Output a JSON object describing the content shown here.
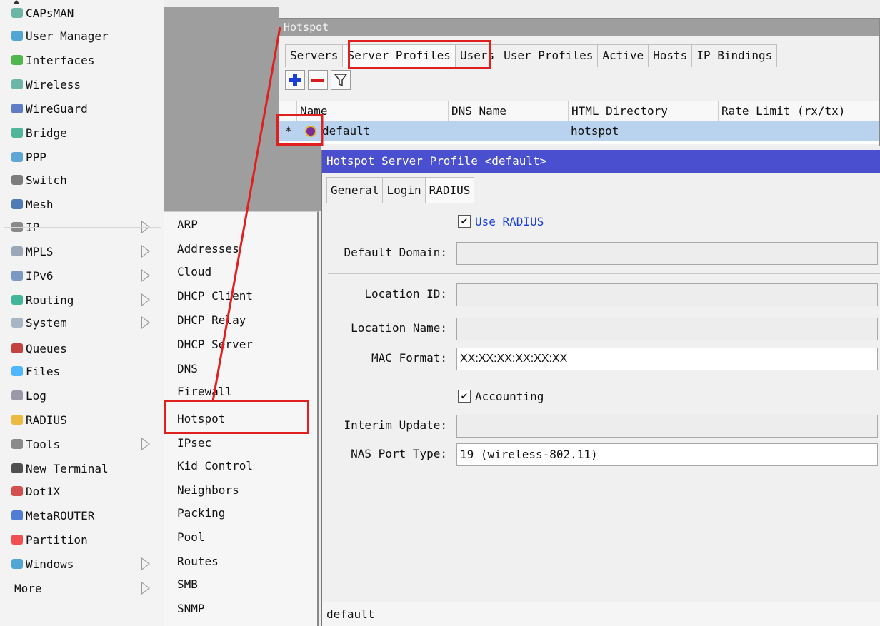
{
  "sidebar": {
    "items": [
      {
        "label": "CAPsMAN",
        "icon": "capsman-icon",
        "submenu": false
      },
      {
        "label": "User Manager",
        "icon": "users-icon",
        "submenu": false
      },
      {
        "label": "Interfaces",
        "icon": "interfaces-icon",
        "submenu": false
      },
      {
        "label": "Wireless",
        "icon": "wireless-icon",
        "submenu": false
      },
      {
        "label": "WireGuard",
        "icon": "wireguard-icon",
        "submenu": false
      },
      {
        "label": "Bridge",
        "icon": "bridge-icon",
        "submenu": false
      },
      {
        "label": "PPP",
        "icon": "ppp-icon",
        "submenu": false
      },
      {
        "label": "Switch",
        "icon": "switch-icon",
        "submenu": false
      },
      {
        "label": "Mesh",
        "icon": "mesh-icon",
        "submenu": false
      },
      {
        "label": "IP",
        "icon": "ip-icon",
        "submenu": true
      },
      {
        "label": "MPLS",
        "icon": "mpls-icon",
        "submenu": true
      },
      {
        "label": "IPv6",
        "icon": "ipv6-icon",
        "submenu": true
      },
      {
        "label": "Routing",
        "icon": "routing-icon",
        "submenu": true
      },
      {
        "label": "System",
        "icon": "system-icon",
        "submenu": true
      },
      {
        "label": "Queues",
        "icon": "queues-icon",
        "submenu": false
      },
      {
        "label": "Files",
        "icon": "files-icon",
        "submenu": false
      },
      {
        "label": "Log",
        "icon": "log-icon",
        "submenu": false
      },
      {
        "label": "RADIUS",
        "icon": "radius-icon",
        "submenu": false
      },
      {
        "label": "Tools",
        "icon": "tools-icon",
        "submenu": true
      },
      {
        "label": "New Terminal",
        "icon": "terminal-icon",
        "submenu": false
      },
      {
        "label": "Dot1X",
        "icon": "dot1x-icon",
        "submenu": false
      },
      {
        "label": "MetaROUTER",
        "icon": "metarouter-icon",
        "submenu": false
      },
      {
        "label": "Partition",
        "icon": "partition-icon",
        "submenu": false
      },
      {
        "label": "Windows",
        "icon": "windows-icon",
        "submenu": true
      },
      {
        "label": "More",
        "icon": "",
        "submenu": true
      }
    ]
  },
  "ip_submenu": {
    "items": [
      "ARP",
      "Addresses",
      "Cloud",
      "DHCP Client",
      "DHCP Relay",
      "DHCP Server",
      "DNS",
      "Firewall",
      "Hotspot",
      "IPsec",
      "Kid Control",
      "Neighbors",
      "Packing",
      "Pool",
      "Routes",
      "SMB",
      "SNMP"
    ],
    "highlighted": "Hotspot"
  },
  "hotspot_window": {
    "title": "Hotspot",
    "tabs": [
      "Servers",
      "Server Profiles",
      "Users",
      "User Profiles",
      "Active",
      "Hosts",
      "IP Bindings"
    ],
    "active_tab": "Server Profiles",
    "columns": [
      "Name",
      "DNS Name",
      "HTML Directory",
      "Rate Limit (rx/tx)"
    ],
    "rows": [
      {
        "marker": "*",
        "name": "default",
        "dns_name": "",
        "html_directory": "hotspot",
        "rate_limit": ""
      }
    ]
  },
  "profile_dialog": {
    "title": "Hotspot Server Profile <default>",
    "tabs": [
      "General",
      "Login",
      "RADIUS"
    ],
    "active_tab": "RADIUS",
    "use_radius_label": "Use RADIUS",
    "use_radius_checked": true,
    "default_domain_label": "Default Domain:",
    "default_domain_value": "",
    "location_id_label": "Location ID:",
    "location_id_value": "",
    "location_name_label": "Location Name:",
    "location_name_value": "",
    "mac_format_label": "MAC Format:",
    "mac_format_value": "XX:XX:XX:XX:XX:XX",
    "accounting_label": "Accounting",
    "accounting_checked": true,
    "interim_update_label": "Interim Update:",
    "interim_update_value": "",
    "nas_port_type_label": "NAS Port Type:",
    "nas_port_type_value": "19 (wireless-802.11)",
    "status_text": "default"
  },
  "colors": {
    "highlight": "#e01f1f",
    "dialog_title": "#4a4fd0",
    "selected_row": "#b9d3ee",
    "link_blue": "#1a3fd6"
  }
}
